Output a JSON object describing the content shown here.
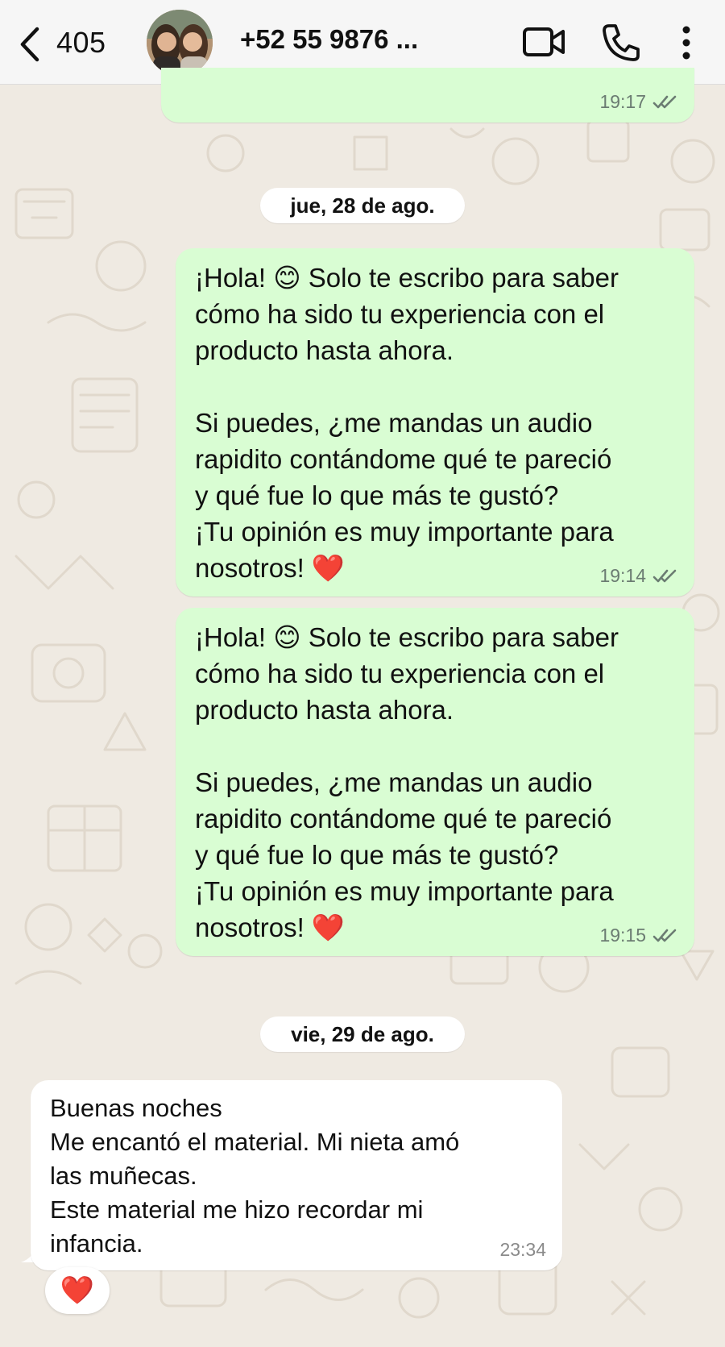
{
  "header": {
    "unread_count": "405",
    "contact_name": "+52 55 9876 ..."
  },
  "icons": {
    "back": "chevron-left-icon",
    "video": "video-camera-icon",
    "call": "phone-icon",
    "more": "vertical-dots-icon"
  },
  "colors": {
    "outgoing_bubble": "#d9fdd3",
    "incoming_bubble": "#ffffff",
    "wallpaper": "#efeae2",
    "read_ticks": "#6b7c72"
  },
  "messages": [
    {
      "direction": "out",
      "text": "",
      "time": "19:17",
      "status": "read"
    },
    {
      "type": "date",
      "label": "jue, 28 de ago."
    },
    {
      "direction": "out",
      "text_line1_pre": "¡Hola! ",
      "text_line1_post": " Solo te escribo para saber",
      "text_rest": "cómo ha sido tu experiencia con el\nproducto hasta ahora.\n\nSi puedes, ¿me mandas un audio\nrapidito contándome qué te pareció\ny qué fue lo que más te gustó?\n¡Tu opinión es muy importante para\nnosotros! ",
      "emoji_smile": "😊",
      "emoji_heart": "❤️",
      "time": "19:14",
      "status": "read"
    },
    {
      "direction": "out",
      "text_line1_pre": "¡Hola! ",
      "text_line1_post": " Solo te escribo para saber",
      "text_rest": "cómo ha sido tu experiencia con el\nproducto hasta ahora.\n\nSi puedes, ¿me mandas un audio\nrapidito contándome qué te pareció\ny qué fue lo que más te gustó?\n¡Tu opinión es muy importante para\nnosotros! ",
      "emoji_smile": "😊",
      "emoji_heart": "❤️",
      "time": "19:15",
      "status": "read"
    },
    {
      "type": "date",
      "label": "vie, 29 de ago."
    },
    {
      "direction": "in",
      "text": "Buenas noches\nMe encantó el material. Mi nieta amó\nlas muñecas.\nEste material me hizo recordar mi\ninfancia.",
      "time": "23:34",
      "reaction": "❤️"
    }
  ]
}
